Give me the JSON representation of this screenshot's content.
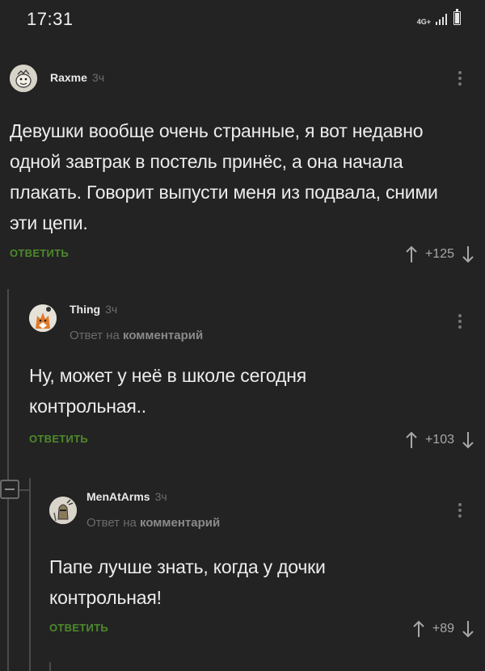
{
  "status_bar": {
    "time": "17:31",
    "network": "4G+",
    "battery_level": 0.9
  },
  "comments": [
    {
      "author": "Raxme",
      "time": "3ч",
      "reply_to_prefix": "",
      "reply_to_target": "",
      "text": "Девушки вообще очень странные, я вот недавно одной завтрак в постель принёс, а она начала плакать. Говорит выпусти меня из подвала, сними эти цепи.",
      "reply_label": "ОТВЕТИТЬ",
      "score": "+125",
      "avatar_icon": "cartoon-avatar-icon"
    },
    {
      "author": "Thing",
      "time": "3ч",
      "reply_to_prefix": "Ответ на",
      "reply_to_target": "комментарий",
      "text": "Ну, может у неё в школе сегодня контрольная..",
      "reply_label": "ОТВЕТИТЬ",
      "score": "+103",
      "avatar_icon": "fox-avatar-icon"
    },
    {
      "author": "MenAtArms",
      "time": "3ч",
      "reply_to_prefix": "Ответ на",
      "reply_to_target": "комментарий",
      "text": "Папе лучше знать, когда у дочки контрольная!",
      "reply_label": "ОТВЕТИТЬ",
      "score": "+89",
      "avatar_icon": "knight-avatar-icon"
    }
  ],
  "colors": {
    "background": "#232323",
    "reply_green": "#4e8a2a",
    "text": "#ececec",
    "muted": "#6e6e6e"
  }
}
